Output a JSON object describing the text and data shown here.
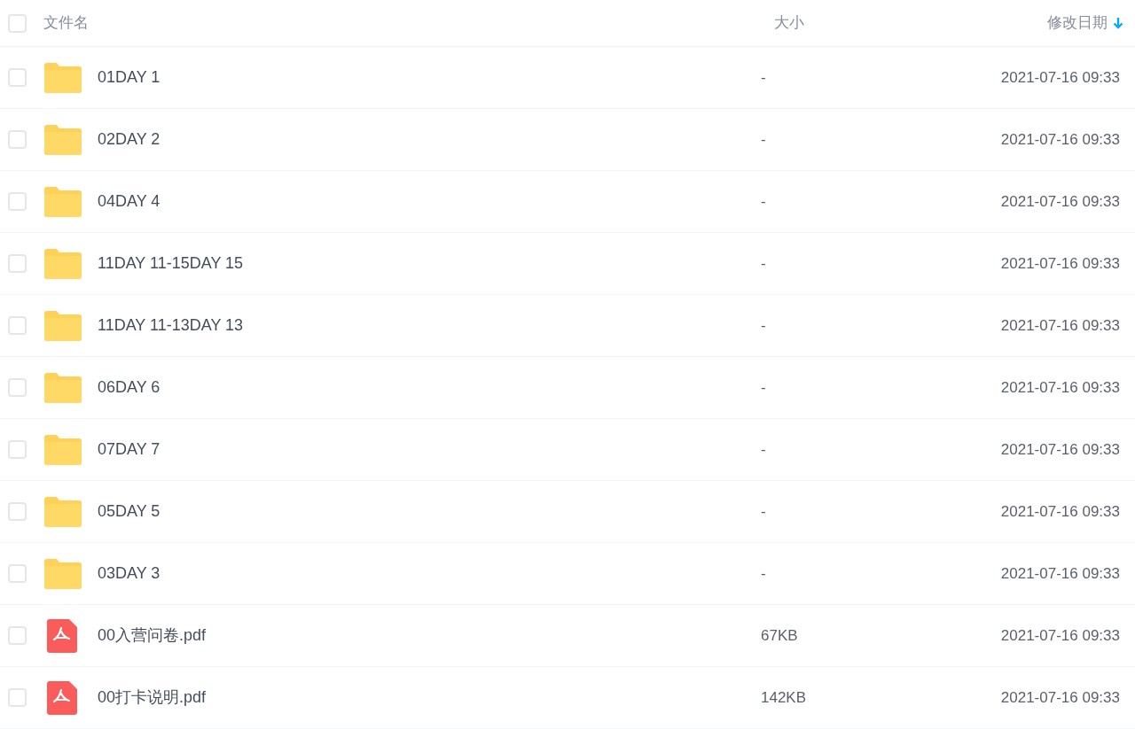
{
  "header": {
    "select_all_checked": false,
    "columns": [
      {
        "label": "文件名"
      },
      {
        "label": "大小"
      },
      {
        "label": "修改日期",
        "sorted": true,
        "descending": true
      }
    ]
  },
  "rows": [
    {
      "kind": "folder",
      "name": "01DAY 1",
      "size": "-",
      "modified": "2021-07-16 09:33",
      "checked": false
    },
    {
      "kind": "folder",
      "name": "02DAY 2",
      "size": "-",
      "modified": "2021-07-16 09:33",
      "checked": false
    },
    {
      "kind": "folder",
      "name": "04DAY 4",
      "size": "-",
      "modified": "2021-07-16 09:33",
      "checked": false
    },
    {
      "kind": "folder",
      "name": "11DAY 11-15DAY 15",
      "size": "-",
      "modified": "2021-07-16 09:33",
      "checked": false
    },
    {
      "kind": "folder",
      "name": "11DAY 11-13DAY 13",
      "size": "-",
      "modified": "2021-07-16 09:33",
      "checked": false
    },
    {
      "kind": "folder",
      "name": "06DAY 6",
      "size": "-",
      "modified": "2021-07-16 09:33",
      "checked": false
    },
    {
      "kind": "folder",
      "name": "07DAY 7",
      "size": "-",
      "modified": "2021-07-16 09:33",
      "checked": false
    },
    {
      "kind": "folder",
      "name": "05DAY 5",
      "size": "-",
      "modified": "2021-07-16 09:33",
      "checked": false
    },
    {
      "kind": "folder",
      "name": "03DAY 3",
      "size": "-",
      "modified": "2021-07-16 09:33",
      "checked": false
    },
    {
      "kind": "pdf",
      "name": "00入营问卷.pdf",
      "size": "67KB",
      "modified": "2021-07-16 09:33",
      "checked": false
    },
    {
      "kind": "pdf",
      "name": "00打卡说明.pdf",
      "size": "142KB",
      "modified": "2021-07-16 09:33",
      "checked": false
    }
  ]
}
